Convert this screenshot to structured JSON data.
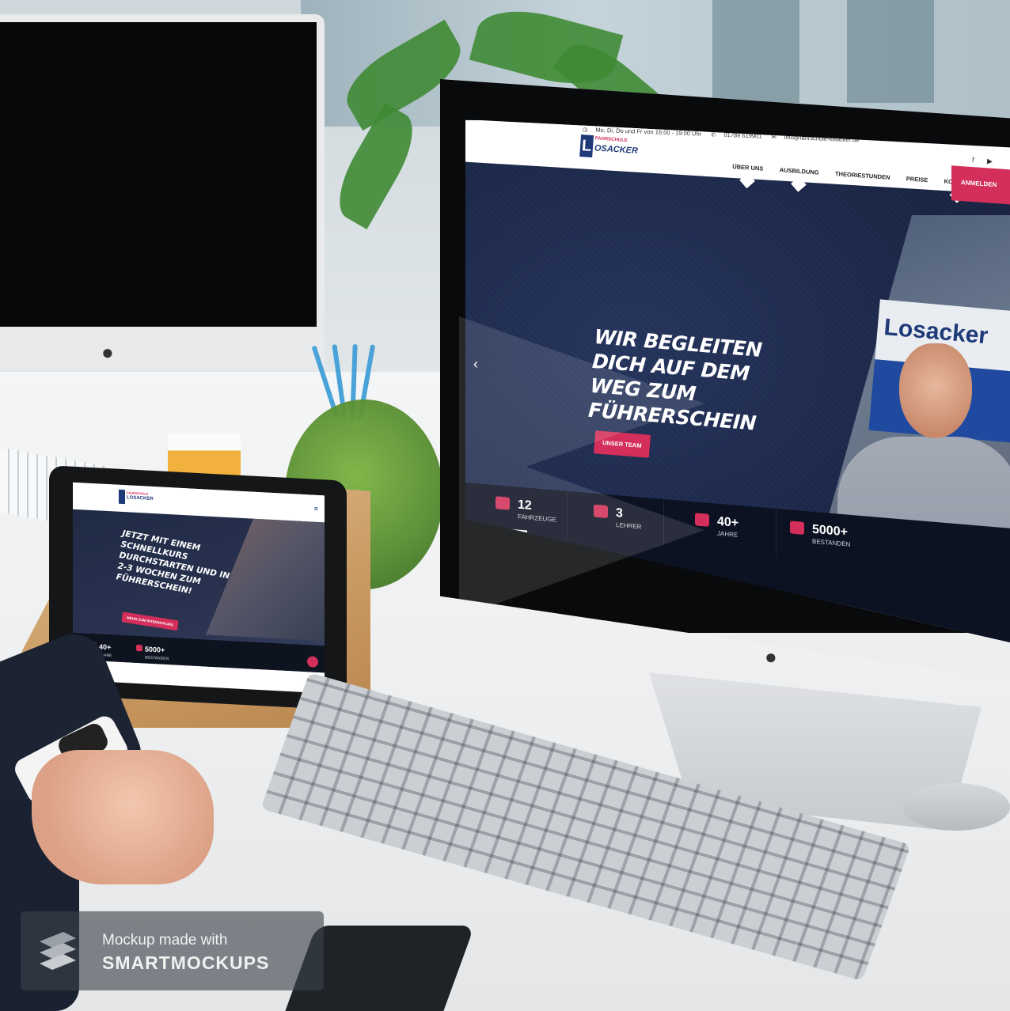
{
  "desktop_site": {
    "topbar": {
      "hours": "Mo, Di, Do und Fr von 16:00 - 19:00 Uhr",
      "phone": "01789 619901",
      "email": "info@fahrschule-losacker.de"
    },
    "logo": {
      "letter": "L",
      "line1": "FAHRSCHULE",
      "line2": "OSACKER"
    },
    "nav": {
      "items": [
        "ÜBER UNS",
        "AUSBILDUNG",
        "THEORIESTUNDEN",
        "PREISE",
        "KONTAKT"
      ],
      "cta": "ANMELDEN",
      "social": [
        "f",
        "▶"
      ]
    },
    "hero": {
      "headline": "WIR BEGLEITEN DICH AUF DEM WEG ZUM FÜHRERSCHEIN",
      "button": "UNSER TEAM",
      "sign_text": "Losacker"
    },
    "stats": [
      {
        "number": "12",
        "label": "FAHRZEUGE"
      },
      {
        "number": "3",
        "label": "LEHRER"
      },
      {
        "number": "40+",
        "label": "JAHRE"
      },
      {
        "number": "5000+",
        "label": "BESTANDEN"
      }
    ]
  },
  "tablet_site": {
    "logo": {
      "line1": "FAHRSCHULE",
      "line2": "LOSACKER"
    },
    "headline": "JETZT MIT EINEM SCHNELLKURS DURCHSTARTEN UND IN 2-3 WOCHEN ZUM FÜHRERSCHEIN!",
    "button": "MEHR ZUM INTENSIVKURS",
    "stats": [
      {
        "number": "40+",
        "label": "JAHRE"
      },
      {
        "number": "5000+",
        "label": "BESTANDEN"
      }
    ]
  },
  "watermark": {
    "line1": "Mockup made with",
    "line2": "SMARTMOCKUPS"
  },
  "colors": {
    "brand_red": "#d32f5a",
    "brand_navy": "#1e3a78",
    "hero_bg": "#1c2845"
  }
}
